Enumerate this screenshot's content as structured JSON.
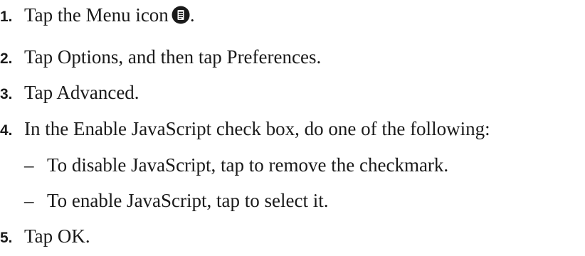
{
  "steps": [
    {
      "number": "1.",
      "text_before_icon": "Tap the Menu icon",
      "icon": "menu-icon",
      "text_after_icon": "."
    },
    {
      "number": "2.",
      "text": "Tap Options, and then tap Preferences."
    },
    {
      "number": "3.",
      "text": "Tap Advanced."
    },
    {
      "number": "4.",
      "text": "In the Enable JavaScript check box, do one of the following:",
      "substeps": [
        {
          "bullet": "–",
          "text": "To disable JavaScript, tap to remove the checkmark."
        },
        {
          "bullet": "–",
          "text": "To enable JavaScript, tap to select it."
        }
      ]
    },
    {
      "number": "5.",
      "text": "Tap OK."
    }
  ]
}
